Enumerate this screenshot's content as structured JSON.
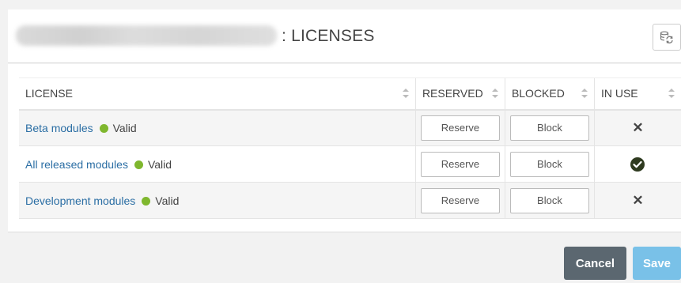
{
  "header": {
    "title": ": LICENSES",
    "refresh_icon": "refresh-database-icon"
  },
  "table": {
    "columns": [
      {
        "label": "LICENSE"
      },
      {
        "label": "RESERVED"
      },
      {
        "label": "BLOCKED"
      },
      {
        "label": "IN USE"
      }
    ],
    "rows": [
      {
        "name": "Beta modules",
        "status": "Valid",
        "reserve_label": "Reserve",
        "block_label": "Block",
        "in_use": false,
        "in_use_icon": "x-icon",
        "in_use_symbol": "✕"
      },
      {
        "name": "All released modules",
        "status": "Valid",
        "reserve_label": "Reserve",
        "block_label": "Block",
        "in_use": true,
        "in_use_icon": "check-circle-icon",
        "in_use_symbol": ""
      },
      {
        "name": "Development modules",
        "status": "Valid",
        "reserve_label": "Reserve",
        "block_label": "Block",
        "in_use": false,
        "in_use_icon": "x-icon",
        "in_use_symbol": "✕"
      }
    ]
  },
  "colors": {
    "valid_dot": "#7fb72e",
    "link": "#2b6ea4",
    "cancel_bg": "#5b6770",
    "save_bg": "#79c1e8"
  },
  "footer": {
    "cancel_label": "Cancel",
    "save_label": "Save"
  }
}
